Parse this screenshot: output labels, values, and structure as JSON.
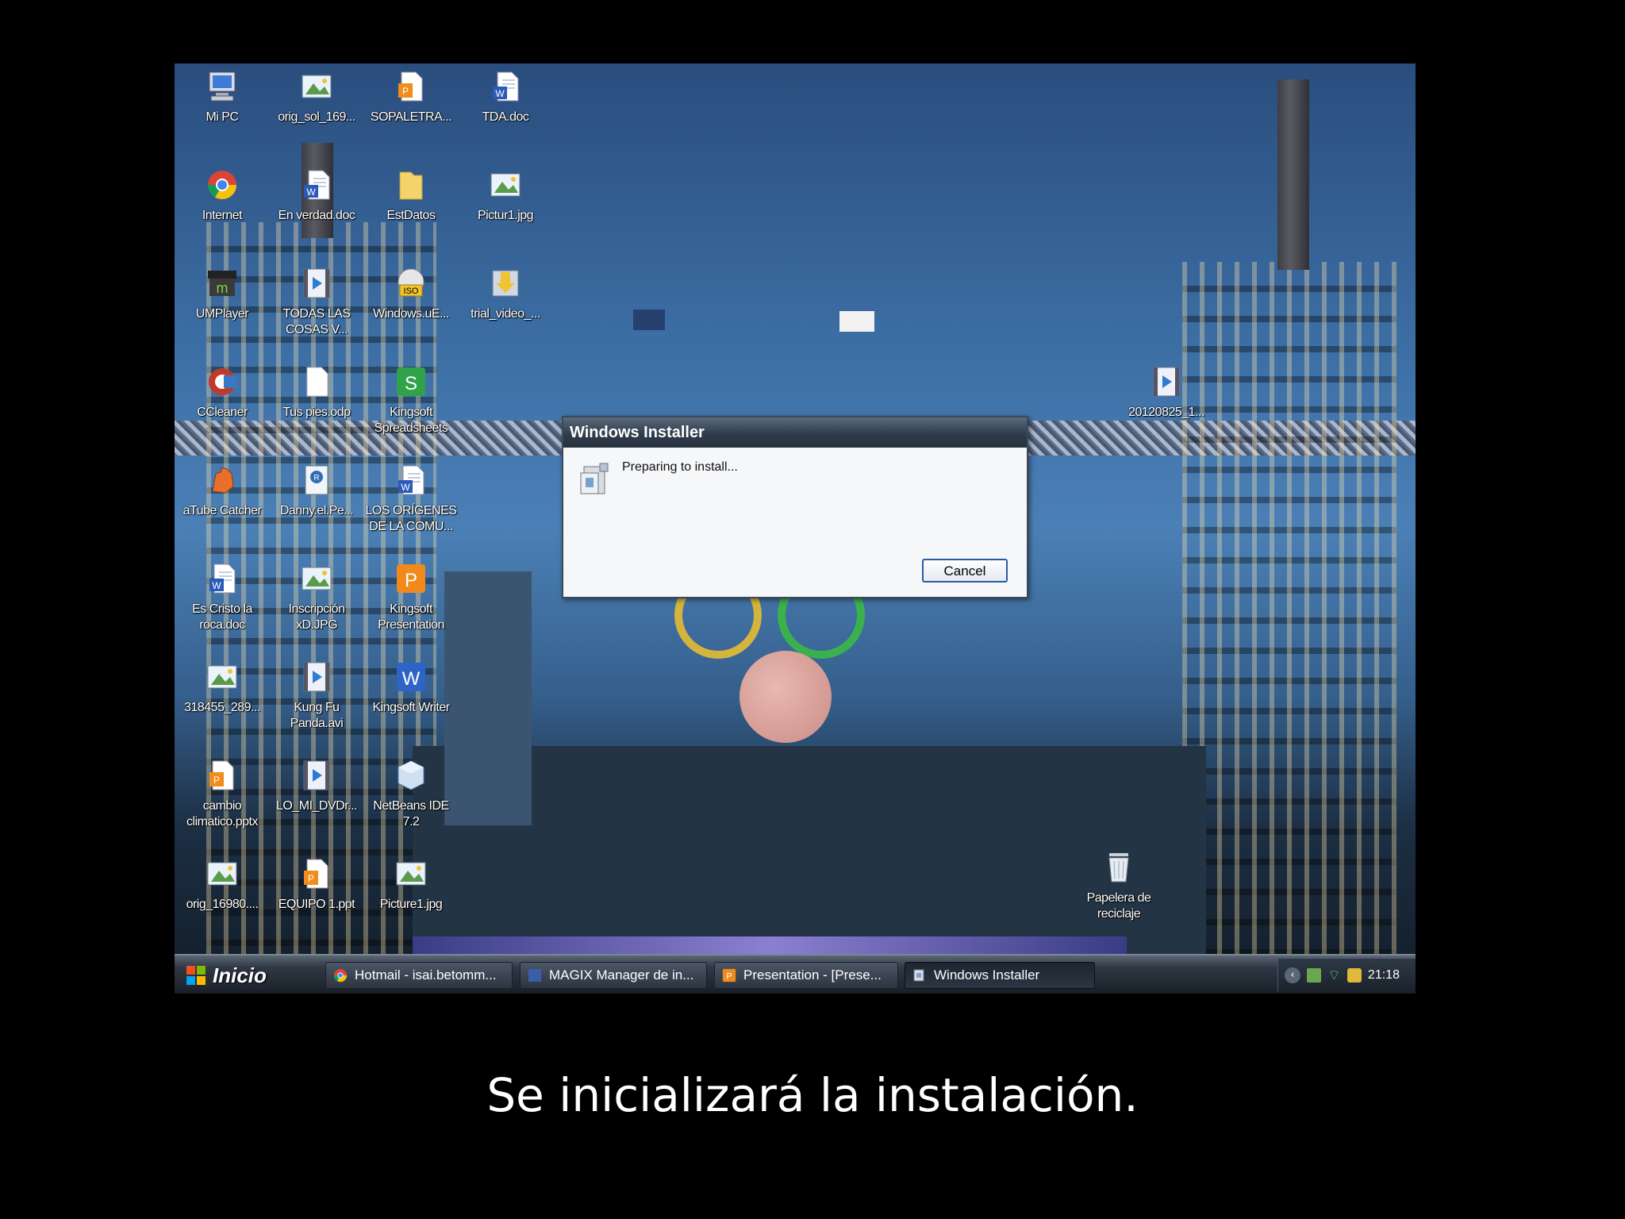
{
  "desktop": {
    "icons": [
      {
        "label": "Mi PC",
        "icon": "my-computer-icon"
      },
      {
        "label": "orig_sol_169...",
        "icon": "image-file-icon"
      },
      {
        "label": "SOPALETRA...",
        "icon": "presentation-file-icon"
      },
      {
        "label": "TDA.doc",
        "icon": "word-document-icon"
      },
      {
        "label": "Internet",
        "icon": "chrome-icon"
      },
      {
        "label": "En verdad.doc",
        "icon": "word-document-icon"
      },
      {
        "label": "EstDatos",
        "icon": "folder-icon"
      },
      {
        "label": "Pictur1.jpg",
        "icon": "image-file-icon"
      },
      {
        "label": "UMPlayer",
        "icon": "umplayer-icon"
      },
      {
        "label": "TODAS LAS\nCOSAS V...",
        "icon": "video-file-icon"
      },
      {
        "label": "Windows.uE...",
        "icon": "iso-disc-icon"
      },
      {
        "label": "trial_video_...",
        "icon": "download-icon"
      },
      {
        "label": "CCleaner",
        "icon": "ccleaner-icon"
      },
      {
        "label": "Tus pies.odp",
        "icon": "blank-document-icon"
      },
      {
        "label": "Kingsoft\nSpreadsheets",
        "icon": "spreadsheet-app-icon"
      },
      {
        "label": "aTube Catcher",
        "icon": "atube-catcher-icon"
      },
      {
        "label": "Danny.el.Pe...",
        "icon": "media-file-icon"
      },
      {
        "label": "LOS ORÍGENES\nDE LA COMU...",
        "icon": "word-document-icon"
      },
      {
        "label": "Es Cristo la\nroca.doc",
        "icon": "word-document-icon"
      },
      {
        "label": "Inscripción\nxD.JPG",
        "icon": "image-file-icon"
      },
      {
        "label": "Kingsoft\nPresentation",
        "icon": "presentation-app-icon"
      },
      {
        "label": "318455_289...",
        "icon": "image-file-icon"
      },
      {
        "label": "Kung Fu\nPanda.avi",
        "icon": "video-file-icon"
      },
      {
        "label": "Kingsoft Writer",
        "icon": "writer-app-icon"
      },
      {
        "label": "cambio\nclimatico.pptx",
        "icon": "presentation-file-icon"
      },
      {
        "label": "LO_MI_DVDr...",
        "icon": "video-file-icon"
      },
      {
        "label": "NetBeans IDE\n7.2",
        "icon": "netbeans-icon"
      },
      {
        "label": "orig_16980....",
        "icon": "image-file-icon"
      },
      {
        "label": "EQUIPO 1.ppt",
        "icon": "presentation-file-icon"
      },
      {
        "label": "Picture1.jpg",
        "icon": "image-file-icon"
      },
      {
        "label": "20120825_1...",
        "icon": "video-file-icon"
      },
      {
        "label": "Papelera de\nreciclaje",
        "icon": "recycle-bin-icon"
      }
    ]
  },
  "dialog": {
    "title": "Windows Installer",
    "message": "Preparing to install...",
    "cancel_label": "Cancel",
    "icon": "installer-icon"
  },
  "taskbar": {
    "start_label": "Inicio",
    "tasks": [
      {
        "label": "Hotmail - isai.betomm...",
        "icon": "chrome-icon"
      },
      {
        "label": "MAGIX Manager de in...",
        "icon": "magix-icon"
      },
      {
        "label": "Presentation - [Prese...",
        "icon": "presentation-app-icon"
      },
      {
        "label": "Windows Installer",
        "icon": "installer-icon",
        "active": true
      }
    ],
    "tray_icons": [
      "back-arrow-icon",
      "network-icon",
      "wifi-icon",
      "security-icon"
    ],
    "clock": "21:18"
  },
  "caption": "Se inicializará la instalación."
}
